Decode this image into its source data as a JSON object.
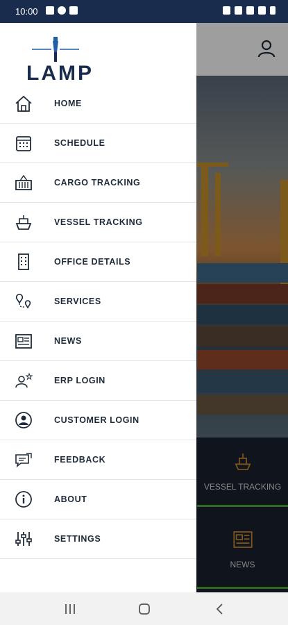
{
  "status_bar": {
    "time": "10:00"
  },
  "app": {
    "brand": "LAMP",
    "menu": [
      {
        "key": "home",
        "label": "HOME",
        "icon": "home-icon"
      },
      {
        "key": "schedule",
        "label": "SCHEDULE",
        "icon": "calendar-icon"
      },
      {
        "key": "cargo",
        "label": "CARGO TRACKING",
        "icon": "container-icon"
      },
      {
        "key": "vessel",
        "label": "VESSEL TRACKING",
        "icon": "ship-icon"
      },
      {
        "key": "office",
        "label": "OFFICE DETAILS",
        "icon": "building-icon"
      },
      {
        "key": "services",
        "label": "SERVICES",
        "icon": "route-pin-icon"
      },
      {
        "key": "news",
        "label": "NEWS",
        "icon": "newspaper-icon"
      },
      {
        "key": "erp",
        "label": "ERP LOGIN",
        "icon": "user-star-icon"
      },
      {
        "key": "customer",
        "label": "CUSTOMER LOGIN",
        "icon": "user-circle-icon"
      },
      {
        "key": "feedback",
        "label": "FEEDBACK",
        "icon": "feedback-icon"
      },
      {
        "key": "about",
        "label": "ABOUT",
        "icon": "info-icon"
      },
      {
        "key": "settings",
        "label": "SETTINGS",
        "icon": "sliders-icon"
      }
    ],
    "background_tiles": [
      {
        "label": "VESSEL TRACKING",
        "icon": "ship-icon"
      },
      {
        "label": "NEWS",
        "icon": "newspaper-icon"
      }
    ]
  },
  "colors": {
    "navy": "#1a2c4d",
    "accent_green": "#53a83a",
    "tile_icon": "#d08c2a"
  }
}
